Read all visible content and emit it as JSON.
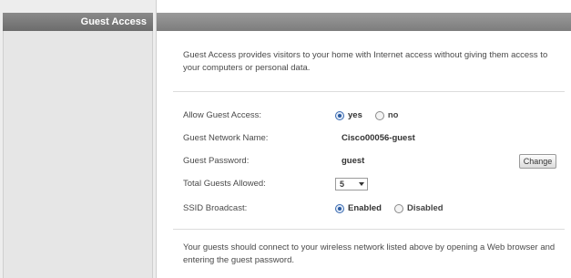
{
  "sidebar": {
    "title": "Guest Access"
  },
  "intro_text": "Guest Access provides visitors to your home with Internet access without giving them access to your computers or personal data.",
  "form": {
    "allow_guest": {
      "label": "Allow Guest Access:",
      "options": [
        "yes",
        "no"
      ],
      "selected": "yes"
    },
    "network_name": {
      "label": "Guest Network Name:",
      "value": "Cisco00056-guest"
    },
    "password": {
      "label": "Guest Password:",
      "value": "guest",
      "button": "Change"
    },
    "total_guests": {
      "label": "Total Guests Allowed:",
      "value": "5"
    },
    "ssid_broadcast": {
      "label": "SSID Broadcast:",
      "options": [
        "Enabled",
        "Disabled"
      ],
      "selected": "Enabled"
    }
  },
  "footer_text": "Your guests should connect to your wireless network listed above by opening a Web browser and entering the guest password.",
  "colors": {
    "radio_selected": "#2a5aa0",
    "header_bar": "#7d7d7d"
  }
}
